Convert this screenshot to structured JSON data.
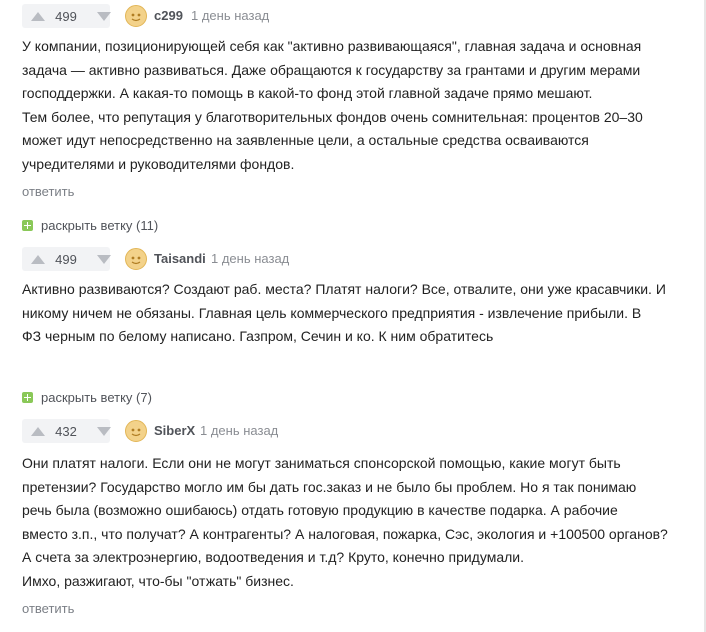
{
  "comments": [
    {
      "score": "499",
      "user": "c299",
      "time": "1 день назад",
      "lines": [
        "У компании, позиционирующей себя как \"активно развивающаяся\", главная задача и основная",
        "задача — активно развиваться. Даже обращаются к государству за грантами и другим мерами",
        "господдержки. А какая-то помощь в какой-то фонд этой главной задаче прямо мешают.",
        "Тем более, что репутация у благотворительных фондов очень сомнительная: процентов 20–30",
        "может идут непосредственно на заявленные цели, а остальные средства осваиваются",
        "учредителями и руководителями фондов."
      ],
      "reply": "ответить"
    },
    {
      "score": "499",
      "user": "Taisandi",
      "time": "1 день назад",
      "lines": [
        "Активно развиваются? Создают раб. места? Платят налоги? Все, отвалите, они уже красавчики. И",
        "никому ничем не обязаны. Главная цель коммерческого предприятия - извлечение прибыли. В",
        "ФЗ черным по белому написано. Газпром, Сечин и ко. К ним обратитесь"
      ]
    },
    {
      "score": "432",
      "user": "SiberX",
      "time": "1 день назад",
      "lines": [
        "Они платят налоги. Если они не могут заниматься спонсорской помощью, какие могут быть",
        "претензии? Государство могло им бы дать гос.заказ и не было бы проблем. Но я так понимаю",
        "речь была (возможно ошибаюсь) отдать готовую продукцию в качестве подарка. А рабочие",
        "вместо з.п., что получат? А контрагенты? А налоговая, пожарка, Сэс, экология и +100500 органов?",
        "А счета за электроэнергию, водоотведения и т.д? Круто, конечно придумали.",
        "Имхо, разжигают, что-бы \"отжать\" бизнес."
      ],
      "reply": "ответить"
    }
  ],
  "expanders": [
    {
      "label": "раскрыть ветку (11)"
    },
    {
      "label": "раскрыть ветку (7)"
    }
  ],
  "colors": {
    "accent_green": "#8ac858",
    "meta": "#8a8d93",
    "avatar": "#f3d28a"
  }
}
